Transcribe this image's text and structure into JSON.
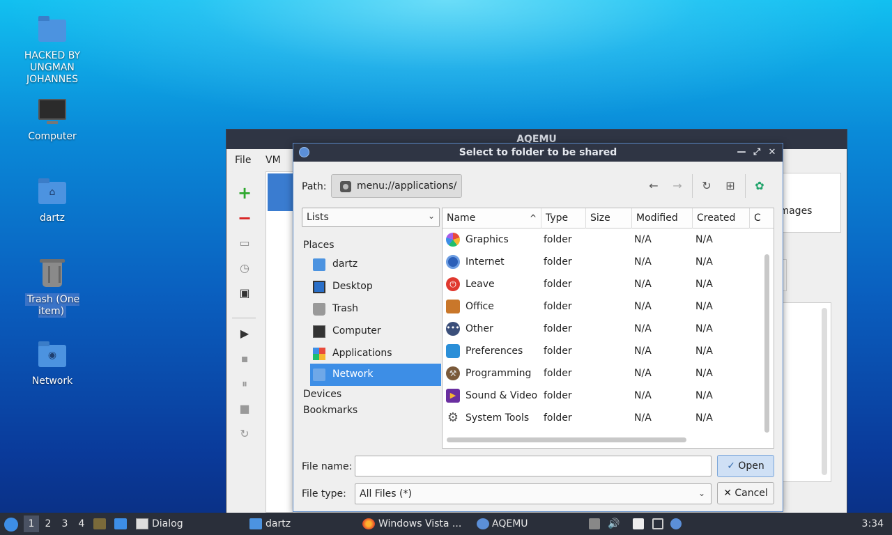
{
  "desktop": {
    "icons": [
      {
        "label": "HACKED BY UNGMAN JOHANNES",
        "icon": "folder-icon"
      },
      {
        "label": "Computer",
        "icon": "computer-icon"
      },
      {
        "label": "dartz",
        "icon": "home-folder-icon"
      },
      {
        "label": "Trash (One item)",
        "icon": "trash-icon"
      },
      {
        "label": "Network",
        "icon": "network-folder-icon"
      }
    ]
  },
  "aqemu": {
    "title": "AQEMU",
    "menu": [
      "File",
      "VM"
    ],
    "right_label": "l Images"
  },
  "dialog": {
    "title": "Select to folder to be shared",
    "path_label": "Path:",
    "path_value": "menu://applications/",
    "lists_label": "Lists",
    "places_header": "Places",
    "places": [
      "dartz",
      "Desktop",
      "Trash",
      "Computer",
      "Applications",
      "Network"
    ],
    "selected_place": "Network",
    "devices_header": "Devices",
    "bookmarks_header": "Bookmarks",
    "columns": [
      "Name",
      "Type",
      "Size",
      "Modified",
      "Created",
      "C"
    ],
    "rows": [
      {
        "name": "Graphics",
        "type": "folder",
        "modified": "N/A",
        "created": "N/A"
      },
      {
        "name": "Internet",
        "type": "folder",
        "modified": "N/A",
        "created": "N/A"
      },
      {
        "name": "Leave",
        "type": "folder",
        "modified": "N/A",
        "created": "N/A"
      },
      {
        "name": "Office",
        "type": "folder",
        "modified": "N/A",
        "created": "N/A"
      },
      {
        "name": "Other",
        "type": "folder",
        "modified": "N/A",
        "created": "N/A"
      },
      {
        "name": "Preferences",
        "type": "folder",
        "modified": "N/A",
        "created": "N/A"
      },
      {
        "name": "Programming",
        "type": "folder",
        "modified": "N/A",
        "created": "N/A"
      },
      {
        "name": "Sound & Video",
        "type": "folder",
        "modified": "N/A",
        "created": "N/A"
      },
      {
        "name": "System Tools",
        "type": "folder",
        "modified": "N/A",
        "created": "N/A"
      }
    ],
    "file_name_label": "File name:",
    "file_name_value": "",
    "file_type_label": "File type:",
    "file_type_value": "All Files (*)",
    "open_label": "Open",
    "cancel_label": "Cancel"
  },
  "taskbar": {
    "workspaces": [
      "1",
      "2",
      "3",
      "4"
    ],
    "tasks": [
      "Dialog",
      "dartz",
      "Windows Vista ...",
      "AQEMU"
    ],
    "clock": "3:34"
  },
  "colors": {
    "accent": "#3d8ee6",
    "titlebar": "#2f3544",
    "taskbar": "#2a2f3a"
  }
}
